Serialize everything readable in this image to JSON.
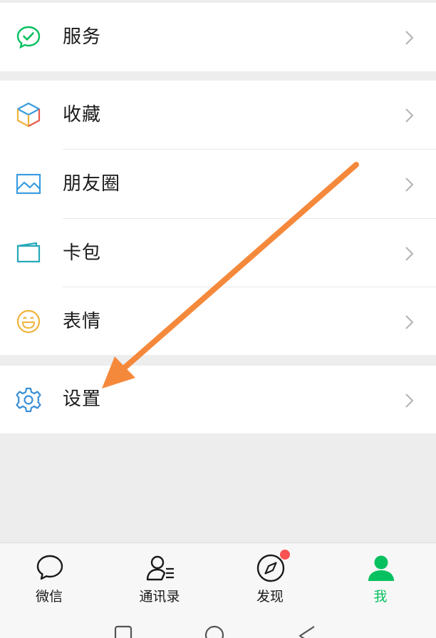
{
  "menu": {
    "group1": [
      {
        "label": "服务",
        "icon": "service-icon"
      }
    ],
    "group2": [
      {
        "label": "收藏",
        "icon": "favorites-icon"
      },
      {
        "label": "朋友圈",
        "icon": "moments-icon"
      },
      {
        "label": "卡包",
        "icon": "card-wallet-icon"
      },
      {
        "label": "表情",
        "icon": "sticker-icon"
      }
    ],
    "group3": [
      {
        "label": "设置",
        "icon": "settings-icon"
      }
    ]
  },
  "tabbar": {
    "tabs": [
      {
        "label": "微信",
        "icon": "chat-icon",
        "active": false
      },
      {
        "label": "通讯录",
        "icon": "contacts-icon",
        "active": false
      },
      {
        "label": "发现",
        "icon": "discover-icon",
        "active": false,
        "badge_dot": true
      },
      {
        "label": "我",
        "icon": "me-icon",
        "active": true
      }
    ]
  },
  "system_nav": {
    "buttons": [
      "recent-apps-icon",
      "home-icon",
      "back-icon"
    ]
  },
  "annotation": {
    "type": "arrow",
    "color": "#f5893b",
    "points_to": "设置"
  },
  "colors": {
    "accent": "#07c160",
    "badge": "#fa5151",
    "background": "#ededed"
  }
}
